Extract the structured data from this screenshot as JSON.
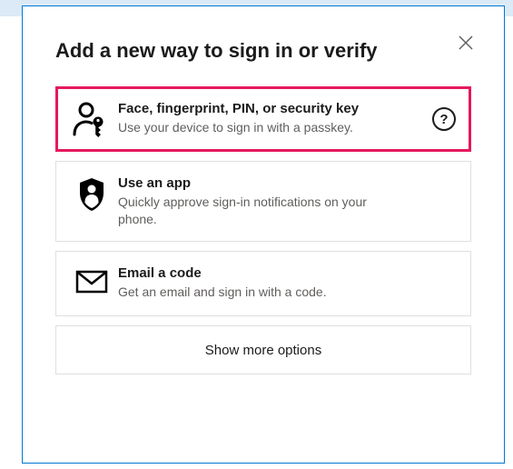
{
  "dialog": {
    "title": "Add a new way to sign in or verify",
    "close_aria": "Close"
  },
  "options": {
    "passkey": {
      "icon": "person-key-icon",
      "title": "Face, fingerprint, PIN, or security key",
      "desc": "Use your device to sign in with a passkey."
    },
    "app": {
      "icon": "authenticator-icon",
      "title": "Use an app",
      "desc": "Quickly approve sign-in notifications on your phone."
    },
    "email": {
      "icon": "mail-icon",
      "title": "Email a code",
      "desc": "Get an email and sign in with a code."
    }
  },
  "more_label": "Show more options",
  "help_symbol": "?"
}
